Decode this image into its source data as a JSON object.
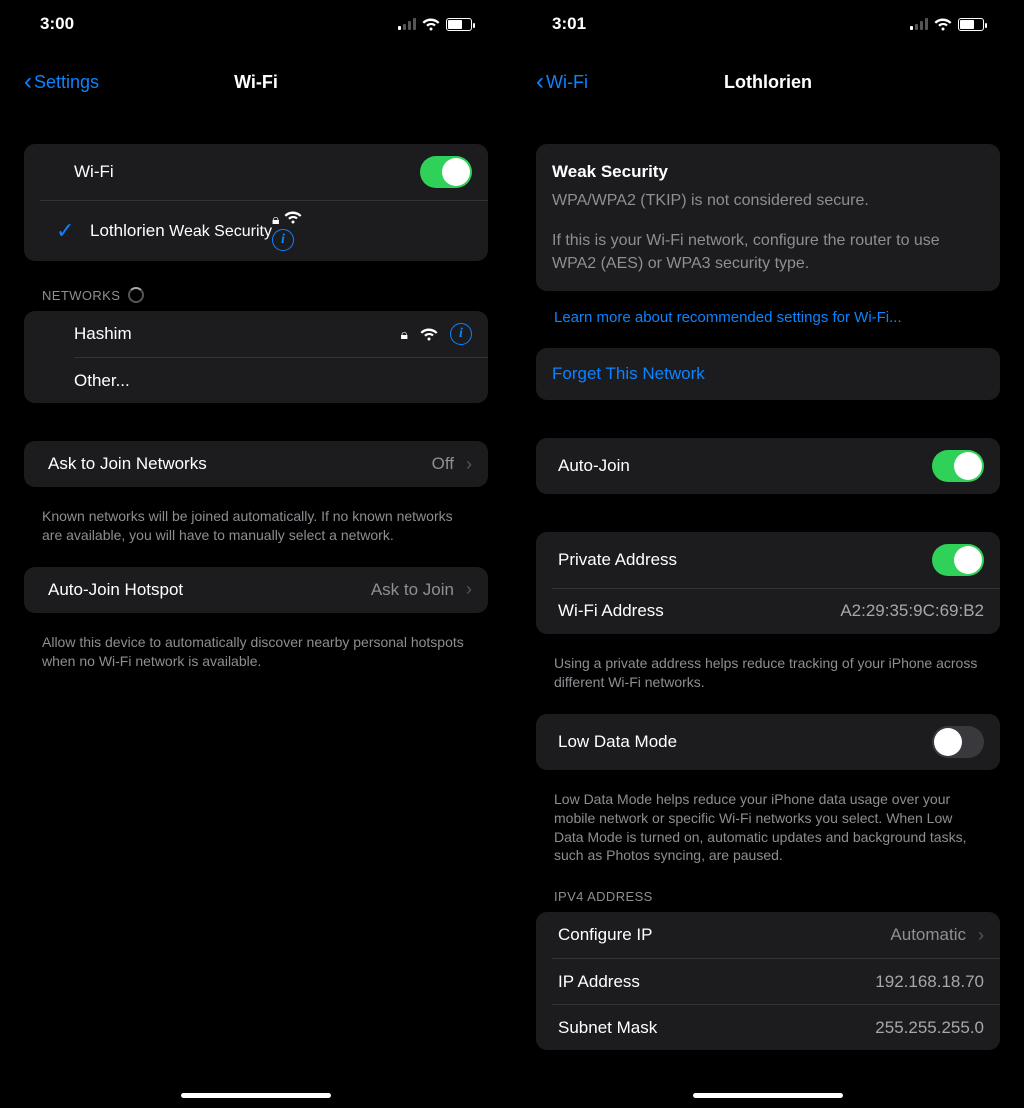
{
  "left": {
    "status": {
      "time": "3:00"
    },
    "nav": {
      "back": "Settings",
      "title": "Wi-Fi"
    },
    "wifi_row": {
      "label": "Wi-Fi"
    },
    "connected": {
      "name": "Lothlorien",
      "sub": "Weak Security"
    },
    "networks_header": "NETWORKS",
    "networks": [
      {
        "name": "Hashim"
      },
      {
        "name": "Other..."
      }
    ],
    "ask": {
      "label": "Ask to Join Networks",
      "value": "Off"
    },
    "ask_footer": "Known networks will be joined automatically. If no known networks are available, you will have to manually select a network.",
    "hotspot": {
      "label": "Auto-Join Hotspot",
      "value": "Ask to Join"
    },
    "hotspot_footer": "Allow this device to automatically discover nearby personal hotspots when no Wi-Fi network is available."
  },
  "right": {
    "status": {
      "time": "3:01"
    },
    "nav": {
      "back": "Wi-Fi",
      "title": "Lothlorien"
    },
    "warning": {
      "title": "Weak Security",
      "line1": "WPA/WPA2 (TKIP) is not considered secure.",
      "line2": "If this is your Wi-Fi network, configure the router to use WPA2 (AES) or WPA3 security type."
    },
    "learn_more": "Learn more about recommended settings for Wi-Fi...",
    "forget": "Forget This Network",
    "autojoin": {
      "label": "Auto-Join"
    },
    "private_addr": {
      "label": "Private Address"
    },
    "wifi_addr": {
      "label": "Wi-Fi Address",
      "value": "A2:29:35:9C:69:B2"
    },
    "private_footer": "Using a private address helps reduce tracking of your iPhone across different Wi-Fi networks.",
    "lowdata": {
      "label": "Low Data Mode"
    },
    "lowdata_footer": "Low Data Mode helps reduce your iPhone data usage over your mobile network or specific Wi-Fi networks you select. When Low Data Mode is turned on, automatic updates and background tasks, such as Photos syncing, are paused.",
    "ipv4_header": "IPV4 ADDRESS",
    "configure_ip": {
      "label": "Configure IP",
      "value": "Automatic"
    },
    "ip_address": {
      "label": "IP Address",
      "value": "192.168.18.70"
    },
    "subnet": {
      "label": "Subnet Mask",
      "value": "255.255.255.0"
    }
  }
}
